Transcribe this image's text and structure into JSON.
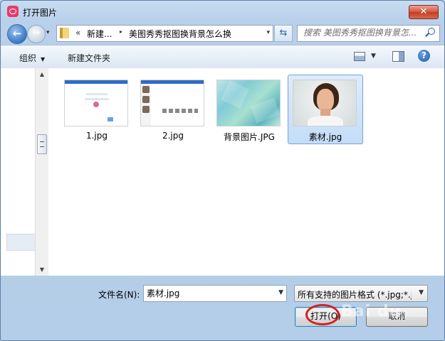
{
  "window": {
    "title": "打开图片",
    "close_glyph": "✕"
  },
  "nav": {
    "back_glyph": "←",
    "forward_glyph": "→",
    "history_glyph": "▾",
    "address": {
      "chevron": "«",
      "crumbs": [
        "新建...",
        "美图秀秀抠图换背景怎么换"
      ],
      "separator_glyph": "▸",
      "dropdown_glyph": "▾"
    },
    "refresh_glyph": "⇆",
    "search": {
      "placeholder": "搜索 美图秀秀抠图换背景怎..."
    }
  },
  "toolbar": {
    "organize_label": "组织",
    "organize_caret": "▼",
    "new_folder_label": "新建文件夹",
    "view_dropdown_glyph": "▼",
    "help_glyph": "?"
  },
  "scrollbar": {
    "up_glyph": "▲",
    "down_glyph": "▼"
  },
  "files": {
    "items": [
      {
        "name": "1.jpg",
        "selected": false
      },
      {
        "name": "2.jpg",
        "selected": false
      },
      {
        "name": "背景图片.JPG",
        "selected": false
      },
      {
        "name": "素材.jpg",
        "selected": true
      }
    ]
  },
  "bottom": {
    "filename_label": "文件名(N):",
    "filename_value": "素材.jpg",
    "filename_dropdown_glyph": "▼",
    "filetype_value": "所有支持的图片格式 (*.jpg;*.jp",
    "filetype_dropdown_glyph": "▼",
    "open_label": "打开(O)",
    "cancel_label": "取消",
    "watermark_text": "Bai du",
    "watermark_sub": "经验"
  },
  "colors": {
    "accent": "#3b78c4",
    "selection": "#c4ddf8",
    "annotation_circle": "#d42020",
    "close_button": "#c43b22"
  }
}
